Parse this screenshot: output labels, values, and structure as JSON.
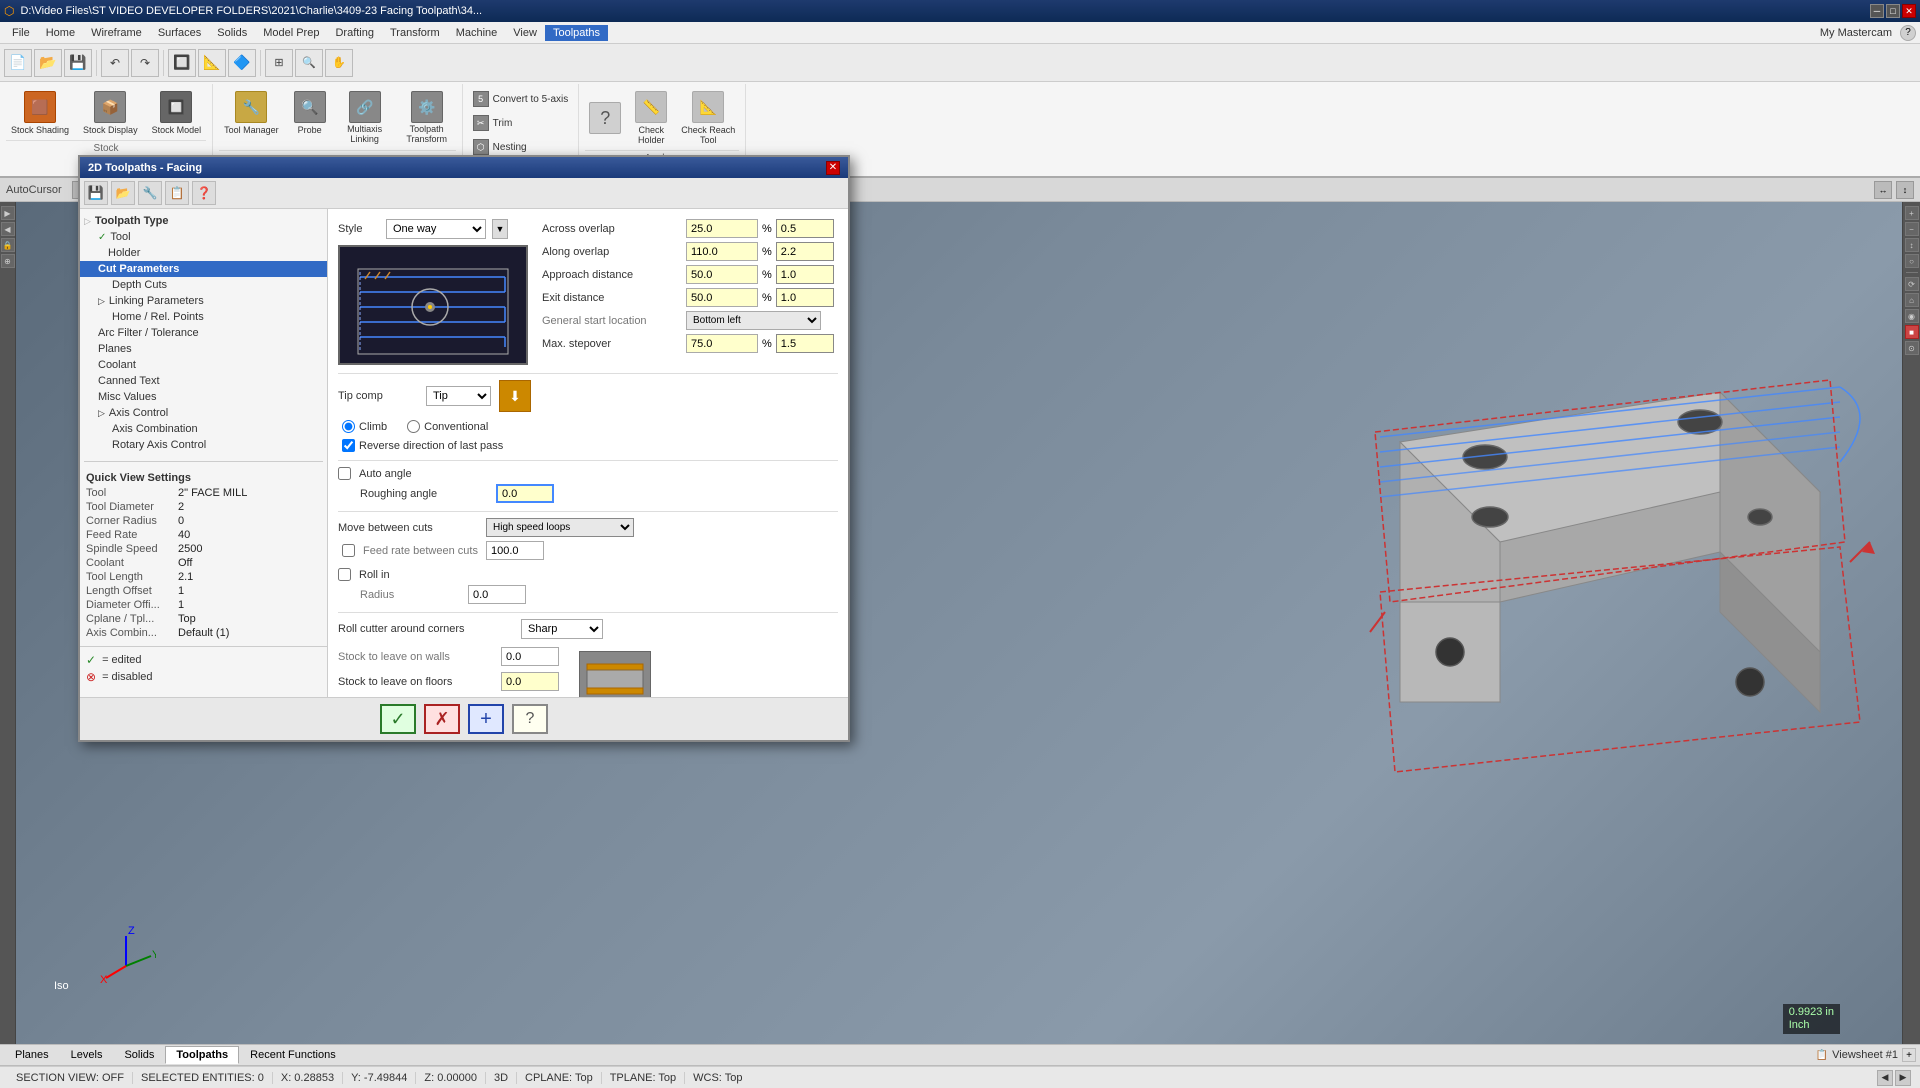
{
  "app": {
    "title": "D:\\Video Files\\ST VIDEO DEVELOPER FOLDERS\\2021\\Charlie\\3409-23 Facing Toolpath\\34...",
    "mastercam_label": "My Mastercam"
  },
  "menu": {
    "items": [
      "File",
      "Home",
      "Wireframe",
      "Surfaces",
      "Solids",
      "Model Prep",
      "Drafting",
      "Transform",
      "Machine",
      "View",
      "Toolpaths"
    ]
  },
  "ribbon": {
    "groups": [
      {
        "label": "Stock",
        "buttons": [
          {
            "icon": "🟫",
            "label": "Stock Shading"
          },
          {
            "icon": "📦",
            "label": "Stock Display"
          },
          {
            "icon": "🔧",
            "label": "Stock Model"
          }
        ]
      },
      {
        "label": "",
        "buttons": [
          {
            "icon": "🔧",
            "label": "Tool Manager"
          },
          {
            "icon": "🔍",
            "label": "Probe"
          },
          {
            "icon": "🔗",
            "label": "Multiaxis Linking"
          },
          {
            "icon": "⚙️",
            "label": "Toolpath Transform"
          }
        ]
      },
      {
        "label": "Utilities",
        "buttons": [
          {
            "icon": "📋",
            "label": "Convert to 5-axis"
          },
          {
            "icon": "✂️",
            "label": "Trim"
          },
          {
            "icon": "📋",
            "label": "Nesting"
          }
        ]
      },
      {
        "label": "Analyze",
        "buttons": [
          {
            "icon": "❓",
            "label": ""
          },
          {
            "icon": "📏",
            "label": "Check Holder"
          },
          {
            "icon": "📐",
            "label": "Check Reach Tool"
          }
        ]
      }
    ]
  },
  "dialog": {
    "title": "2D Toolpaths - Facing",
    "toolbar_buttons": [
      "💾",
      "📂",
      "🔧",
      "📋",
      "❓"
    ],
    "tree": {
      "items": [
        {
          "label": "Toolpath Type",
          "level": 0,
          "checked": false,
          "selected": false
        },
        {
          "label": "Tool",
          "level": 1,
          "checked": true,
          "selected": false
        },
        {
          "label": "Holder",
          "level": 1,
          "checked": false,
          "selected": false
        },
        {
          "label": "Cut Parameters",
          "level": 1,
          "checked": false,
          "selected": true
        },
        {
          "label": "Depth Cuts",
          "level": 2,
          "checked": false,
          "selected": false
        },
        {
          "label": "Linking Parameters",
          "level": 1,
          "checked": false,
          "selected": false
        },
        {
          "label": "Home / Rel. Points",
          "level": 2,
          "checked": false,
          "selected": false
        },
        {
          "label": "Arc Filter / Tolerance",
          "level": 1,
          "checked": false,
          "selected": false
        },
        {
          "label": "Planes",
          "level": 1,
          "checked": false,
          "selected": false
        },
        {
          "label": "Coolant",
          "level": 1,
          "checked": false,
          "selected": false
        },
        {
          "label": "Canned Text",
          "level": 1,
          "checked": false,
          "selected": false
        },
        {
          "label": "Misc Values",
          "level": 1,
          "checked": false,
          "selected": false
        },
        {
          "label": "Axis Control",
          "level": 1,
          "checked": false,
          "selected": false
        },
        {
          "label": "Axis Combination",
          "level": 2,
          "checked": false,
          "selected": false
        },
        {
          "label": "Rotary Axis Control",
          "level": 2,
          "checked": false,
          "selected": false
        }
      ]
    },
    "style": {
      "label": "Style",
      "value": "One way"
    },
    "tip_comp": {
      "label": "Tip comp",
      "value": "Tip"
    },
    "roll_cutter": {
      "label": "Roll cutter around corners",
      "value": "Sharp"
    },
    "params": {
      "across_overlap": {
        "label": "Across overlap",
        "pct": "25.0",
        "val": "0.5"
      },
      "along_overlap": {
        "label": "Along overlap",
        "pct": "110.0",
        "val": "2.2"
      },
      "approach_distance": {
        "label": "Approach distance",
        "pct": "50.0",
        "val": "1.0"
      },
      "exit_distance": {
        "label": "Exit distance",
        "pct": "50.0",
        "val": "1.0"
      },
      "general_start": {
        "label": "General start location",
        "val": "Bottom left"
      },
      "max_stepover": {
        "label": "Max. stepover",
        "pct": "75.0",
        "val": "1.5"
      }
    },
    "motion": {
      "climb_label": "Climb",
      "conventional_label": "Conventional",
      "climb_checked": true,
      "conventional_checked": false,
      "reverse_last_pass": "Reverse direction of last pass",
      "reverse_checked": true
    },
    "angles": {
      "auto_angle_label": "Auto angle",
      "auto_angle_checked": false,
      "roughing_angle_label": "Roughing angle",
      "roughing_angle_val": "0.0"
    },
    "move_between": {
      "label": "Move between cuts",
      "value": "High speed loops",
      "feed_rate_label": "Feed rate between cuts",
      "feed_rate_checked": false,
      "feed_rate_val": "100.0"
    },
    "roll_in": {
      "label": "Roll in",
      "checked": false,
      "radius_label": "Radius",
      "radius_val": "0.0"
    },
    "stock_leave": {
      "walls_label": "Stock to leave on walls",
      "walls_val": "0.0",
      "floors_label": "Stock to leave on floors",
      "floors_val": "0.0"
    },
    "footer_buttons": {
      "ok": "✓",
      "cancel": "✗",
      "add": "+",
      "help": "?"
    }
  },
  "quick_view": {
    "title": "Quick View Settings",
    "rows": [
      {
        "label": "Tool",
        "value": "2\" FACE MILL"
      },
      {
        "label": "Tool Diameter",
        "value": "2"
      },
      {
        "label": "Corner Radius",
        "value": "0"
      },
      {
        "label": "Feed Rate",
        "value": "40"
      },
      {
        "label": "Spindle Speed",
        "value": "2500"
      },
      {
        "label": "Coolant",
        "value": "Off"
      },
      {
        "label": "Tool Length",
        "value": "2.1"
      },
      {
        "label": "Length Offset",
        "value": "1"
      },
      {
        "label": "Diameter Offi...",
        "value": "1"
      },
      {
        "label": "Cplane / Tpl...",
        "value": "Top"
      },
      {
        "label": "Axis Combin...",
        "value": "Default (1)"
      }
    ]
  },
  "legend": [
    {
      "symbol": "✓",
      "label": "= edited",
      "color": "#2a8a2a"
    },
    {
      "symbol": "⊗",
      "label": "= disabled",
      "color": "#cc2222"
    }
  ],
  "bottom_tabs": [
    "Planes",
    "Levels",
    "Solids",
    "Toolpaths",
    "Recent Functions"
  ],
  "active_tab": "Toolpaths",
  "status_bar": {
    "section_view": "SECTION VIEW: OFF",
    "selected_entities": "SELECTED ENTITIES: 0",
    "x_coord": "X: 0.28853",
    "y_coord": "Y: -7.49844",
    "z_coord": "Z: 0.00000",
    "dim": "3D",
    "cplane": "CPLANE: Top",
    "tplane": "TPLANE: Top",
    "wcs": "WCS: Top"
  },
  "viewport": {
    "cursor_label": "AutoCursor",
    "iso_label": "Iso",
    "scale_label": "0.9923 in",
    "unit_label": "Inch"
  }
}
